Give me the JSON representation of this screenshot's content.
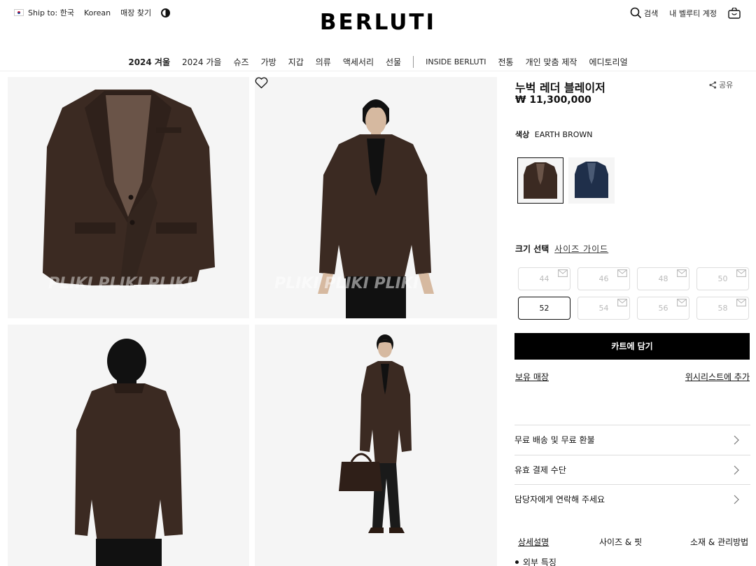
{
  "header": {
    "ship_to": "Ship to: 한국",
    "language": "Korean",
    "store_finder": "매장 찾기",
    "logo": "BERLUTI",
    "search": "검색",
    "account": "내 벨루티 계정"
  },
  "nav": {
    "items": [
      "2024 겨울",
      "2024 가을",
      "슈즈",
      "가방",
      "지갑",
      "의류",
      "액세서리",
      "선물"
    ],
    "items_right": [
      "INSIDE BERLUTI",
      "전통",
      "개인 맞춤 제작",
      "에디토리얼"
    ]
  },
  "gallery": {
    "watermark": "PLIKI PLIKI PLIKI",
    "watermark2": "PLIKI PLIKI PLIKI"
  },
  "product": {
    "title": "누벅 레더 블레이저",
    "share": "공유",
    "price": "₩ 11,300,000",
    "color_label": "색상",
    "color_value": "EARTH BROWN",
    "size_label": "크기 선택",
    "size_guide": "사이즈 가이드",
    "sizes": [
      "44",
      "46",
      "48",
      "50",
      "52",
      "54",
      "56",
      "58"
    ],
    "available_size": "52",
    "add_to_cart": "카트에 담기",
    "store_stock": "보유 매장",
    "add_wishlist": "위시리스트에 추가"
  },
  "accordion": [
    "무료 배송 및 무료 환불",
    "유효 결제 수단",
    "담당자에게 연락해 주세요"
  ],
  "tabs": [
    "상세설명",
    "사이즈 & 핏",
    "소재 & 관리방법"
  ],
  "details": {
    "first_bullet": "외부 특징"
  },
  "colors": {
    "brand": "#000000",
    "jacket_brown": "#3b2a22",
    "jacket_navy": "#1f2f4a"
  }
}
